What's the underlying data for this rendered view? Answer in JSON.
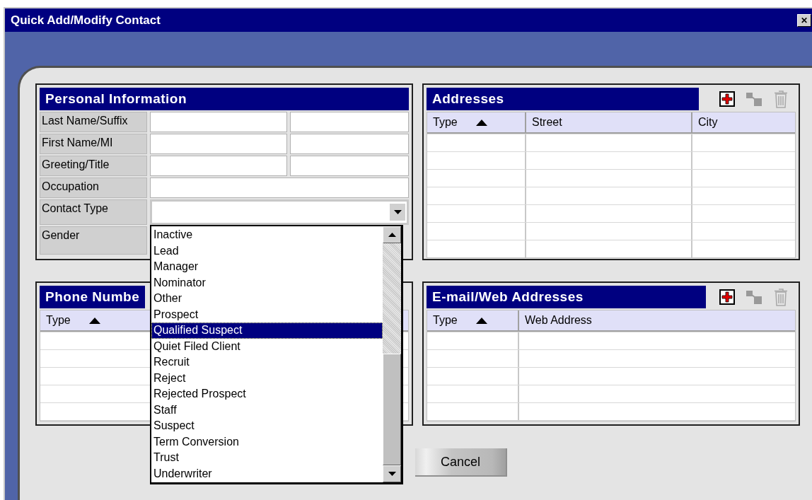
{
  "window": {
    "title": "Quick Add/Modify Contact",
    "close": "✕"
  },
  "personal_information": {
    "title": "Personal Information",
    "rows": [
      {
        "label": "Last Name/Suffix",
        "kind": "double"
      },
      {
        "label": "First Name/MI",
        "kind": "double"
      },
      {
        "label": "Greeting/Title",
        "kind": "double"
      },
      {
        "label": "Occupation",
        "kind": "single"
      },
      {
        "label": "Contact Type",
        "kind": "combo"
      },
      {
        "label": "Gender",
        "kind": "covered"
      }
    ]
  },
  "addresses": {
    "title": "Addresses",
    "columns": [
      {
        "label": "Type",
        "sorted": true
      },
      {
        "label": "Street",
        "sorted": false
      },
      {
        "label": "City",
        "sorted": false
      }
    ],
    "toolbar": [
      {
        "kind": "add",
        "disabled": false
      },
      {
        "kind": "link",
        "disabled": true
      },
      {
        "kind": "delete",
        "disabled": true
      }
    ]
  },
  "phone_numbers": {
    "title": "Phone Numbe",
    "columns": [
      {
        "label": "Type",
        "sorted": true
      }
    ]
  },
  "email_web_addresses": {
    "title": "E-mail/Web Addresses",
    "columns": [
      {
        "label": "Type",
        "sorted": true
      },
      {
        "label": "Web Address",
        "sorted": false
      }
    ],
    "toolbar": [
      {
        "kind": "add",
        "disabled": false
      },
      {
        "kind": "link",
        "disabled": true
      },
      {
        "kind": "delete",
        "disabled": true
      }
    ]
  },
  "contact_type_list": {
    "items": [
      {
        "label": "Inactive",
        "selected": false
      },
      {
        "label": "Lead",
        "selected": false
      },
      {
        "label": "Manager",
        "selected": false
      },
      {
        "label": "Nominator",
        "selected": false
      },
      {
        "label": "Other",
        "selected": false
      },
      {
        "label": "Prospect",
        "selected": false
      },
      {
        "label": "Qualified Suspect",
        "selected": true
      },
      {
        "label": "Quiet Filed Client",
        "selected": false
      },
      {
        "label": "Recruit",
        "selected": false
      },
      {
        "label": "Reject",
        "selected": false
      },
      {
        "label": "Rejected Prospect",
        "selected": false
      },
      {
        "label": "Staff",
        "selected": false
      },
      {
        "label": "Suspect",
        "selected": false
      },
      {
        "label": "Term Conversion",
        "selected": false
      },
      {
        "label": "Trust",
        "selected": false
      },
      {
        "label": "Underwriter",
        "selected": false
      }
    ]
  },
  "cancel_button": {
    "label": "Cancel"
  }
}
